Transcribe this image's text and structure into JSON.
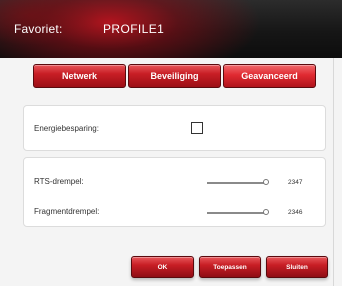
{
  "header": {
    "label": "Favoriet:",
    "profile": "PROFILE1"
  },
  "tabs": [
    {
      "label": "Netwerk",
      "active": false
    },
    {
      "label": "Beveiliging",
      "active": false
    },
    {
      "label": "Geavanceerd",
      "active": true
    }
  ],
  "settings": {
    "power_saving": {
      "label": "Energiebesparing:",
      "checked": false
    },
    "rts_threshold": {
      "label": "RTS-drempel:",
      "value": "2347"
    },
    "fragment_threshold": {
      "label": "Fragmentdrempel:",
      "value": "2346"
    }
  },
  "buttons": {
    "ok": "OK",
    "apply": "Toepassen",
    "close": "Sluiten"
  },
  "colors": {
    "accent": "#c81e25",
    "titlebar": "#161616"
  }
}
